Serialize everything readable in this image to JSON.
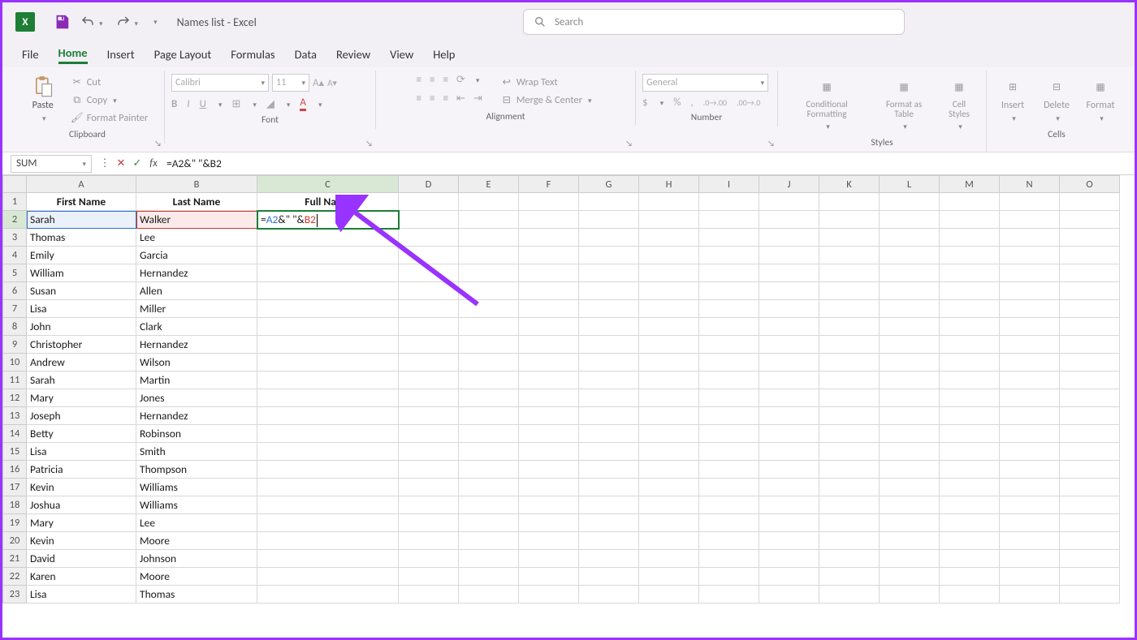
{
  "title": "Names list  -  Excel",
  "search_placeholder": "Search",
  "tabs": [
    "File",
    "Home",
    "Insert",
    "Page Layout",
    "Formulas",
    "Data",
    "Review",
    "View",
    "Help"
  ],
  "active_tab": "Home",
  "ribbon": {
    "clipboard": {
      "paste": "Paste",
      "cut": "Cut",
      "copy": "Copy",
      "painter": "Format Painter",
      "label": "Clipboard"
    },
    "font": {
      "name": "Calibri",
      "size": "11",
      "label": "Font"
    },
    "alignment": {
      "wrap": "Wrap Text",
      "merge": "Merge & Center",
      "label": "Alignment"
    },
    "number": {
      "format": "General",
      "label": "Number"
    },
    "styles": {
      "cond": "Conditional Formatting",
      "table": "Format as Table",
      "cell": "Cell Styles",
      "label": "Styles"
    },
    "cells": {
      "insert": "Insert",
      "delete": "Delete",
      "format": "Format",
      "label": "Cells"
    }
  },
  "namebox": "SUM",
  "formula": "=A2&\" \"&B2",
  "formula_tokens": {
    "pre": "=",
    "a": "A2",
    "mid": "&\" \"&",
    "b": "B2"
  },
  "columns": [
    "A",
    "B",
    "C",
    "D",
    "E",
    "F",
    "G",
    "H",
    "I",
    "J",
    "K",
    "L",
    "M",
    "N",
    "O"
  ],
  "headers": [
    "First Name",
    "Last Name",
    "Full Name"
  ],
  "rows": [
    [
      "Sarah",
      "Walker"
    ],
    [
      "Thomas",
      "Lee"
    ],
    [
      "Emily",
      "Garcia"
    ],
    [
      "William",
      "Hernandez"
    ],
    [
      "Susan",
      "Allen"
    ],
    [
      "Lisa",
      "Miller"
    ],
    [
      "John",
      "Clark"
    ],
    [
      "Christopher",
      "Hernandez"
    ],
    [
      "Andrew",
      "Wilson"
    ],
    [
      "Sarah",
      "Martin"
    ],
    [
      "Mary",
      "Jones"
    ],
    [
      "Joseph",
      "Hernandez"
    ],
    [
      "Betty",
      "Robinson"
    ],
    [
      "Lisa",
      "Smith"
    ],
    [
      "Patricia",
      "Thompson"
    ],
    [
      "Kevin",
      "Williams"
    ],
    [
      "Joshua",
      "Williams"
    ],
    [
      "Mary",
      "Lee"
    ],
    [
      "Kevin",
      "Moore"
    ],
    [
      "David",
      "Johnson"
    ],
    [
      "Karen",
      "Moore"
    ],
    [
      "Lisa",
      "Thomas"
    ]
  ]
}
